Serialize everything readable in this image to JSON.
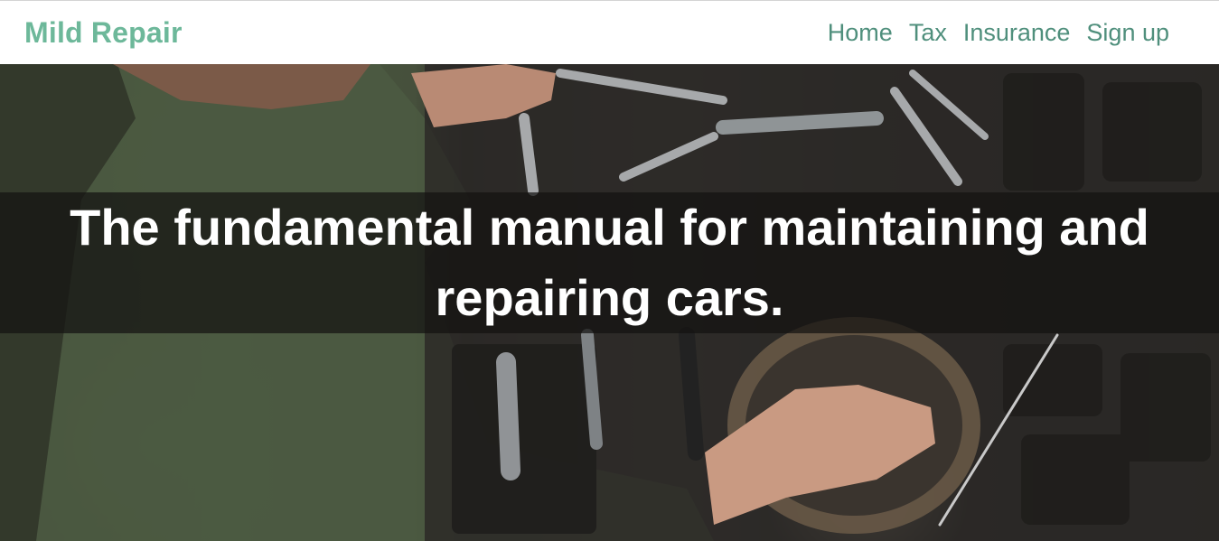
{
  "navbar": {
    "brand": "Mild Repair",
    "links": [
      {
        "label": "Home"
      },
      {
        "label": "Tax"
      },
      {
        "label": "Insurance"
      },
      {
        "label": "Sign up"
      }
    ]
  },
  "hero": {
    "headline": "The fundamental manual for maintaining and repairing cars.",
    "image_description_icon": "car-tools-photo-icon"
  },
  "colors": {
    "brand": "#6db89a",
    "nav_link": "#4f8f7c",
    "headline": "#ffffff",
    "banner_overlay": "rgba(20,18,16,0.72)"
  }
}
